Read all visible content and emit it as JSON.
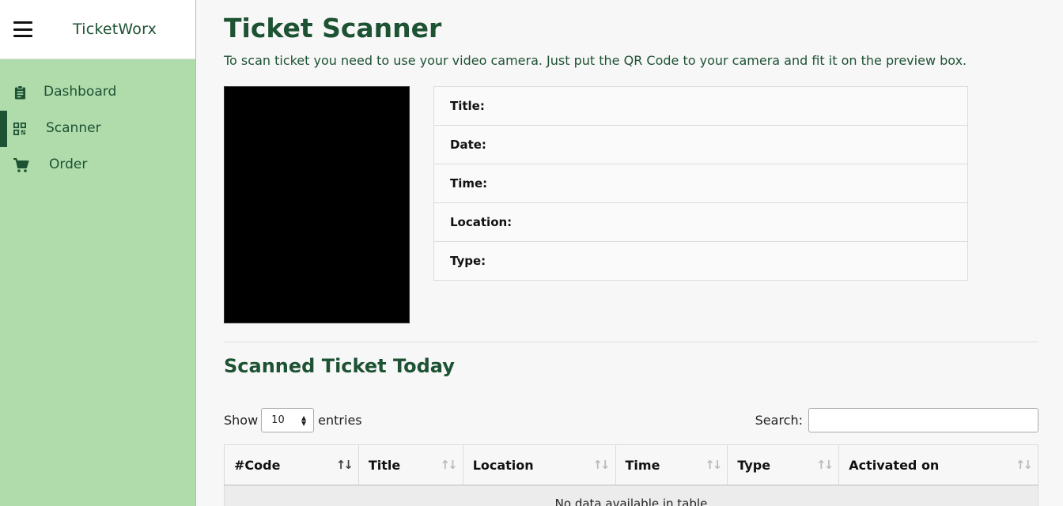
{
  "sidebar": {
    "brand": "TicketWorx",
    "items": [
      {
        "label": "Dashboard",
        "icon": "clipboard-icon",
        "active": false
      },
      {
        "label": "Scanner",
        "icon": "qr-code-icon",
        "active": true
      },
      {
        "label": "Order",
        "icon": "cart-icon",
        "active": false
      }
    ]
  },
  "main": {
    "title": "Ticket Scanner",
    "description": "To scan ticket you need to use your video camera. Just put the QR Code to your camera and fit it on the preview box.",
    "ticket_info": {
      "title_label": "Title:",
      "date_label": "Date:",
      "time_label": "Time:",
      "location_label": "Location:",
      "type_label": "Type:"
    },
    "scanned_section": {
      "title": "Scanned Ticket Today",
      "show_label": "Show",
      "entries_value": "10",
      "entries_label": "entries",
      "search_label": "Search:",
      "search_value": "",
      "columns": [
        "#Code",
        "Title",
        "Location",
        "Time",
        "Type",
        "Activated on"
      ],
      "empty_message": "No data available in table"
    }
  },
  "colors": {
    "sidebar_bg": "#b0dcac",
    "brand_green": "#1d5233",
    "page_bg": "#f7f7f7"
  }
}
